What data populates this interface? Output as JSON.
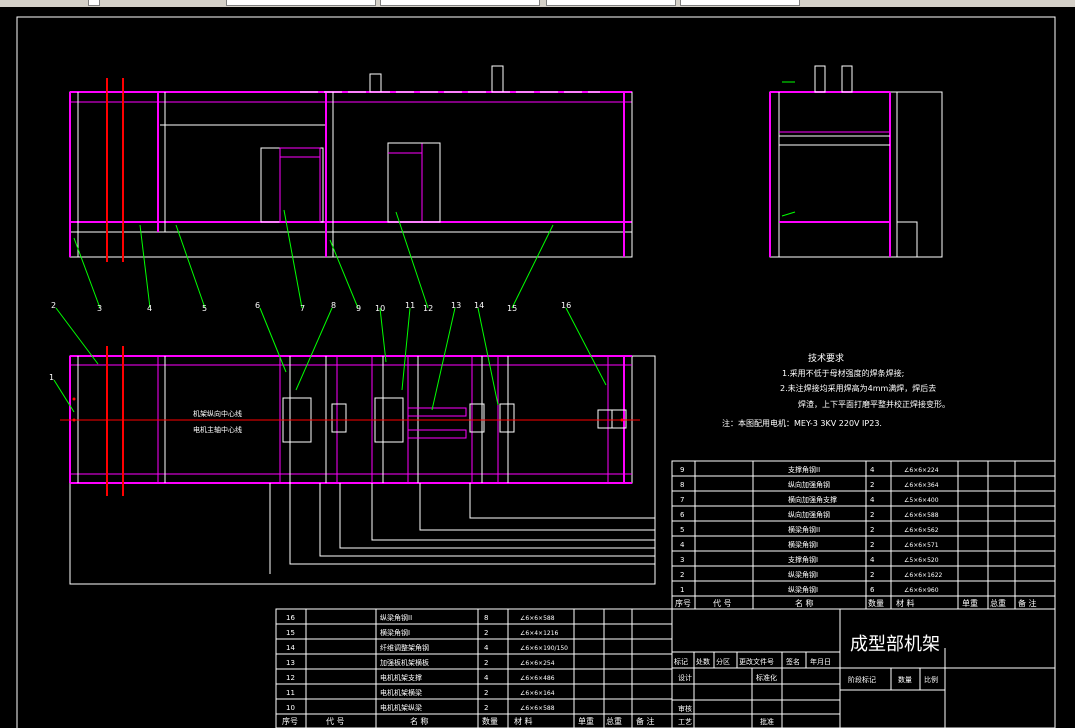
{
  "title": "成型部机架",
  "tech": {
    "heading": "技术要求",
    "lines": [
      "1.采用不低于母材强度的焊条焊接;",
      "2.未注焊接均采用焊高为4mm满焊，焊后去",
      "焊渣，上下平面打磨平整并校正焊接变形。"
    ],
    "note": "注：本图配用电机：MEY-3 3KV 220V IP23."
  },
  "centerline_labels": [
    "机架纵向中心线",
    "电机主轴中心线"
  ],
  "balloons": [
    "2",
    "3",
    "4",
    "5",
    "6",
    "7",
    "8",
    "9",
    "10",
    "11",
    "12",
    "13",
    "14",
    "15",
    "16",
    "1"
  ],
  "bom_upper": {
    "rows": [
      [
        "9",
        "",
        "支撑角钢II",
        "4",
        "∠6×6×224"
      ],
      [
        "8",
        "",
        "纵向加强角钢",
        "2",
        "∠6×6×364"
      ],
      [
        "7",
        "",
        "横向加强角支撑",
        "4",
        "∠5×6×400"
      ],
      [
        "6",
        "",
        "纵向加强角钢",
        "2",
        "∠6×6×588"
      ],
      [
        "5",
        "",
        "横梁角钢II",
        "2",
        "∠6×6×562"
      ],
      [
        "4",
        "",
        "横梁角钢I",
        "2",
        "∠6×6×571"
      ],
      [
        "3",
        "",
        "支撑角钢I",
        "4",
        "∠5×6×520"
      ],
      [
        "2",
        "",
        "纵梁角钢I",
        "2",
        "∠6×6×1622"
      ],
      [
        "1",
        "",
        "纵梁角钢I",
        "6",
        "∠6×6×960"
      ]
    ],
    "header": [
      "序号",
      "代 号",
      "名 称",
      "数量",
      "材 料",
      "单重",
      "总重",
      "备 注"
    ]
  },
  "bom_lower": {
    "rows": [
      [
        "16",
        "",
        "纵梁角钢II",
        "8",
        "∠6×6×588"
      ],
      [
        "15",
        "",
        "横梁角钢I",
        "2",
        "∠6×4×1216"
      ],
      [
        "14",
        "",
        "纤维调整架角钢",
        "4",
        "∠6×6×190/150"
      ],
      [
        "13",
        "",
        "加强板机架横板",
        "2",
        "∠6×6×254"
      ],
      [
        "12",
        "",
        "电机机架支撑",
        "4",
        "∠6×6×486"
      ],
      [
        "11",
        "",
        "电机机架横梁",
        "2",
        "∠6×6×164"
      ],
      [
        "10",
        "",
        "电机机架纵梁",
        "2",
        "∠6×6×588"
      ]
    ],
    "header": [
      "序号",
      "代 号",
      "名 称",
      "数量",
      "材 料",
      "单重",
      "总重",
      "备 注"
    ]
  },
  "titleblock": {
    "row1": [
      "标记",
      "处数",
      "分区",
      "更改文件号",
      "签名",
      "年月日"
    ],
    "design": "设计",
    "standard": "标准化",
    "stage": "阶段标记",
    "qty": "数量",
    "scale": "比例",
    "review": "审核",
    "craft": "工艺",
    "approve": "批准"
  },
  "colors": {
    "frame": "#ff00ff",
    "outline": "#ffffff",
    "leader": "#00ff00",
    "centerline": "#ff0000"
  }
}
